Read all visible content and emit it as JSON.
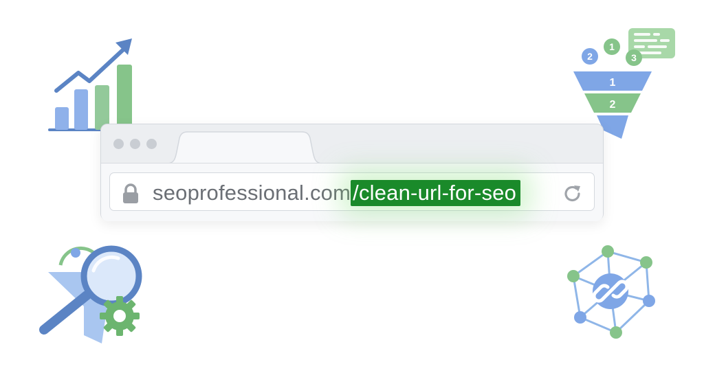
{
  "address_bar": {
    "domain": "seoprofessional.com",
    "path": "/clean-url-for-seo"
  },
  "funnel": {
    "tier_1_label": "1",
    "tier_2_label": "2",
    "badges": [
      "2",
      "1",
      "3"
    ]
  },
  "icons": {
    "lock": "lock-icon",
    "reload": "reload-icon",
    "growth_chart": "growth-chart-icon",
    "funnel": "conversion-funnel-icon",
    "search_settings": "search-gear-icon",
    "link_network": "link-network-icon"
  },
  "colors": {
    "path_highlight": "#1a8a2a",
    "glow": "#78dc6e",
    "blue": "#7fa6e6",
    "green": "#86c48a"
  }
}
